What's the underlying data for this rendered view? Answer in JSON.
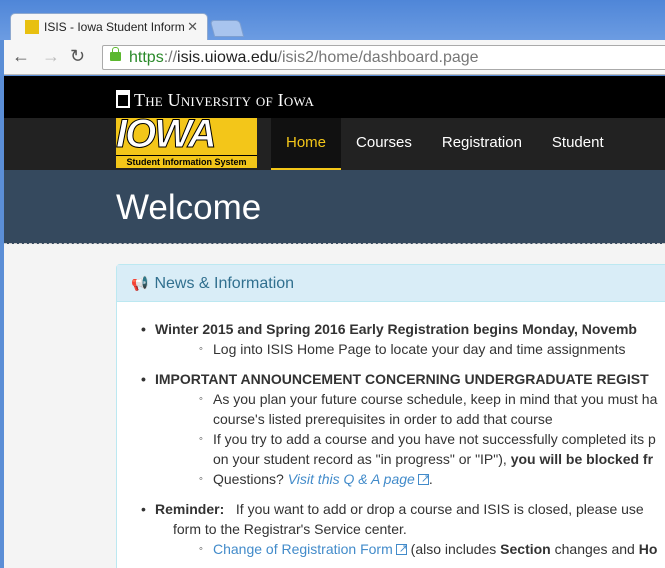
{
  "browser": {
    "tab_title": "ISIS - Iowa Student Inform",
    "url_scheme": "https",
    "url_sep": "://",
    "url_host": "isis.uiowa.edu",
    "url_path": "/isis2/home/dashboard.page"
  },
  "header": {
    "university": "The University of Iowa",
    "logo_word": "IOWA",
    "logo_sub": "Student Information System"
  },
  "nav": [
    {
      "label": "Home"
    },
    {
      "label": "Courses"
    },
    {
      "label": "Registration"
    },
    {
      "label": "Student Records"
    }
  ],
  "welcome": "Welcome",
  "panel": {
    "title": "News & Information",
    "l1": "Winter 2015 and Spring 2016 Early Registration begins Monday, Novemb",
    "l2": "Log into ISIS Home Page to locate your day and time assignments",
    "l3": "IMPORTANT ANNOUNCEMENT CONCERNING UNDERGRADUATE REGIST",
    "l4": "As you plan your future course schedule, keep in mind that you must ha",
    "l5": "course's listed prerequisites in order to add that course",
    "l6": "If you try to add a course and you have not successfully completed its p",
    "l7a": "on your student record as \"in progress\" or \"IP\"), ",
    "l7b": "you will be blocked fr",
    "l8a": "Questions?  ",
    "l8b": "Visit this Q & A page",
    "l8c": ".",
    "l9a": "Reminder:",
    "l9b": "   If you want to add or drop a course and ISIS is closed, please use",
    "l10": "form to the Registrar's Service center.",
    "l11a": "Change of Registration Form",
    "l11b": " (also includes ",
    "l11c": "Section",
    "l11d": " changes and ",
    "l11e": "Ho"
  }
}
